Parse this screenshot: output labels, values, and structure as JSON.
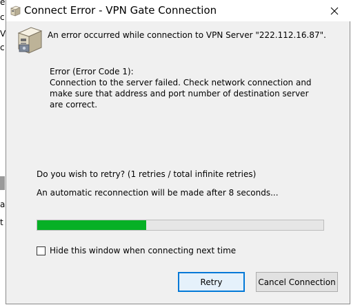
{
  "background_window": {
    "edge_chars": [
      "e",
      "c",
      "V",
      "c",
      "a",
      "t"
    ]
  },
  "titlebar": {
    "title": "Connect Error - VPN Gate Connection",
    "icon": "vpn-server-icon",
    "close_icon": "close-icon"
  },
  "dialog": {
    "icon": "vpn-server-icon",
    "main_message": "An error occurred while connection to VPN Server \"222.112.16.87\".",
    "error_lines": [
      "Error (Error Code 1):",
      "Connection to the server failed. Check network connection and",
      "make sure that address and port number of destination server",
      "are correct."
    ],
    "retry_question": "Do you wish to retry? (1 retries / total infinite retries)",
    "auto_reconnect_message": "An automatic reconnection will be made after 8 seconds...",
    "progress": 0.38,
    "progress_color": "#06b025",
    "hide_checkbox": {
      "label": "Hide this window when connecting next time",
      "checked": false
    },
    "buttons": {
      "retry": "Retry",
      "cancel": "Cancel Connection"
    },
    "accent_color": "#0078d7"
  }
}
